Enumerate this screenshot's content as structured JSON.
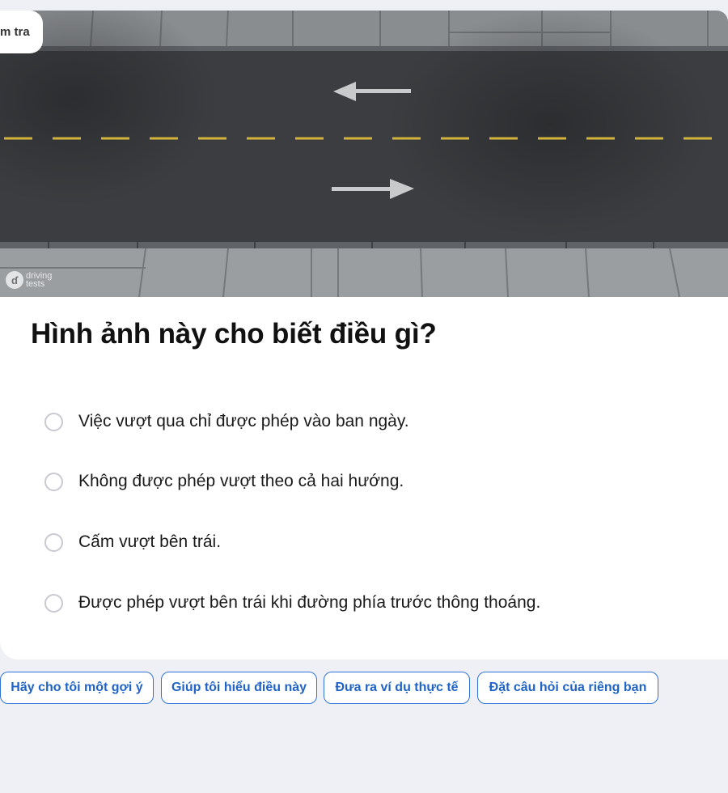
{
  "header": {
    "tab_label": "m tra"
  },
  "image": {
    "watermark_line1": "driving",
    "watermark_line2": "tests",
    "arrow_icons": [
      "arrow-left-icon",
      "arrow-right-icon"
    ]
  },
  "question": {
    "title": "Hình ảnh này cho biết điều gì?"
  },
  "options": [
    {
      "label": "Việc vượt qua chỉ được phép vào ban ngày."
    },
    {
      "label": "Không được phép vượt theo cả hai hướng."
    },
    {
      "label": "Cấm vượt bên trái."
    },
    {
      "label": "Được phép vượt bên trái khi đường phía trước thông thoáng."
    }
  ],
  "suggestions": [
    {
      "label": "Hãy cho tôi một gợi ý"
    },
    {
      "label": "Giúp tôi hiểu điều này"
    },
    {
      "label": "Đưa ra ví dụ thực tế"
    },
    {
      "label": "Đặt câu hỏi của riêng bạn"
    }
  ],
  "colors": {
    "background": "#eff0f5",
    "accent": "#2f73d8",
    "road": "#3b3d40",
    "lane_marking": "#d4b33a"
  }
}
